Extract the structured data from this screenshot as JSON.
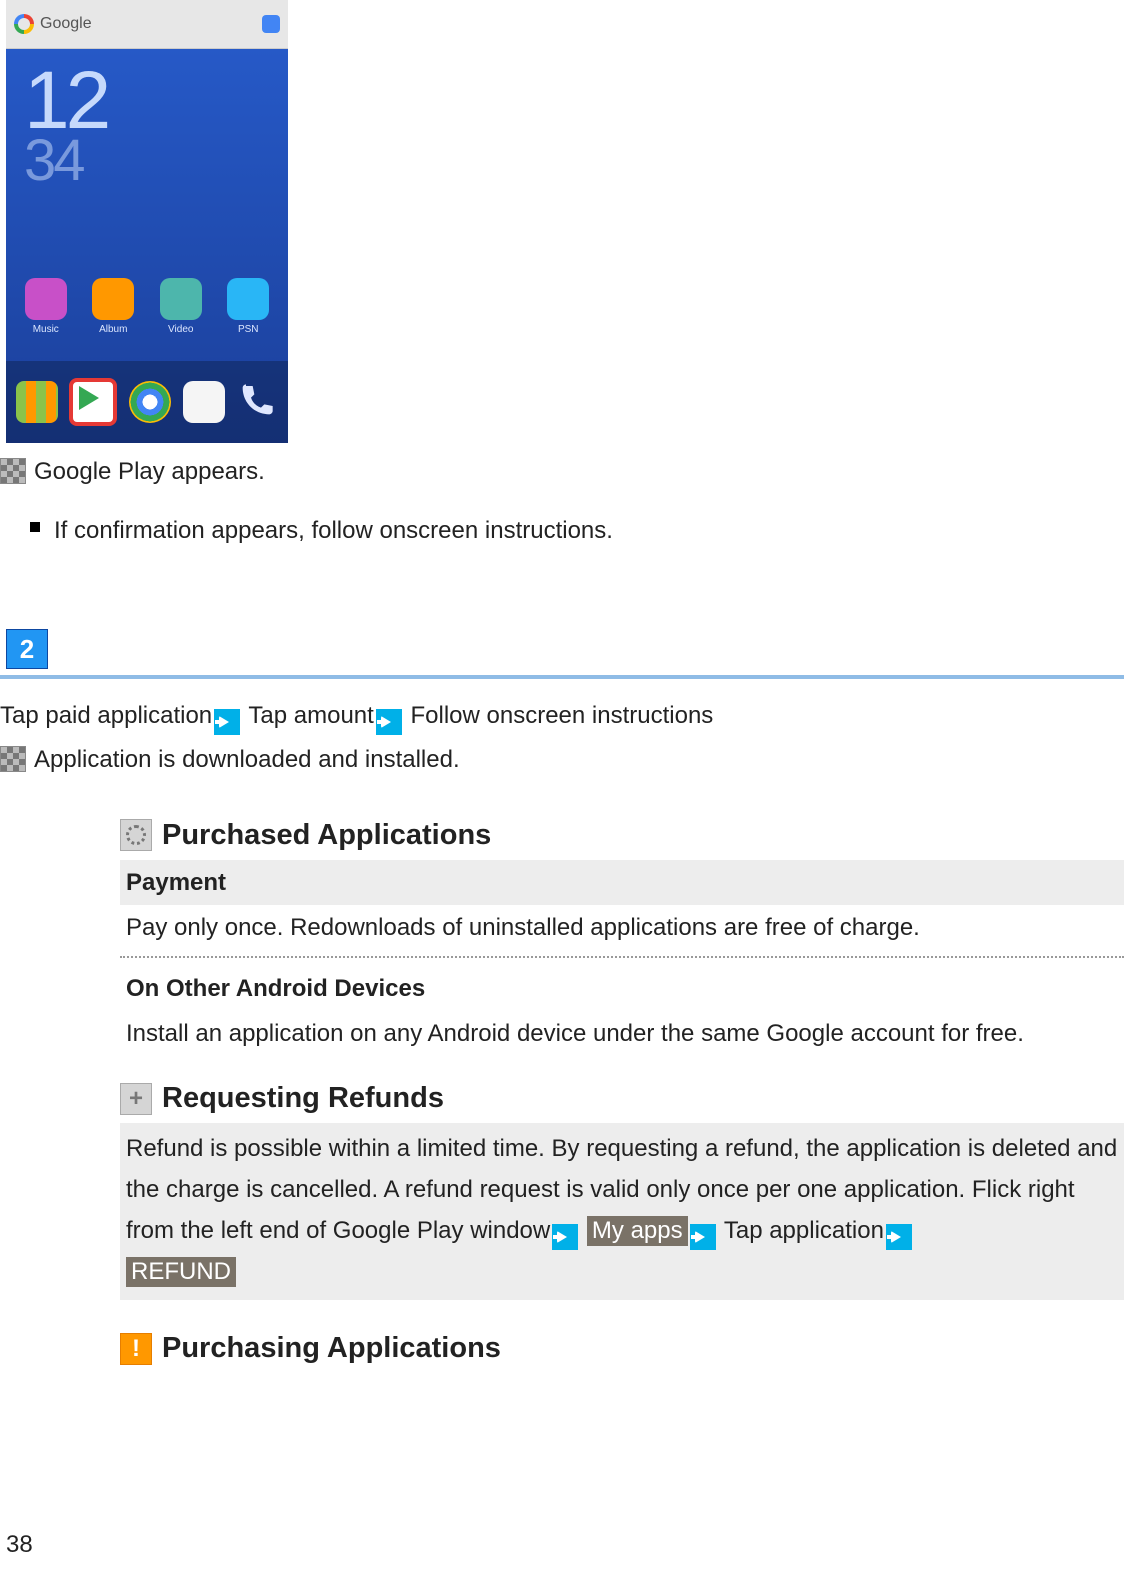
{
  "phone": {
    "status_text": "Google",
    "clock_big": "12",
    "clock_small": "34",
    "clock_date": "",
    "app_row": [
      {
        "label": "Music",
        "color": "#c850c8"
      },
      {
        "label": "Album",
        "color": "#ff9800"
      },
      {
        "label": "Video",
        "color": "#4db6ac"
      },
      {
        "label": "PSN",
        "color": "#29b6f6"
      }
    ]
  },
  "line_google_play": "Google Play appears.",
  "line_confirmation": "If confirmation appears, follow onscreen instructions.",
  "step_number": "2",
  "step2": {
    "part1": "Tap paid application",
    "part2": "Tap amount",
    "part3": "Follow onscreen instructions"
  },
  "line_downloaded": "Application is downloaded and installed.",
  "sec_purchased": {
    "title": "Purchased Applications",
    "payment_title": "Payment",
    "payment_body": "Pay only once. Redownloads of uninstalled applications are free of charge.",
    "other_title": "On Other Android Devices",
    "other_body": "Install an application on any Android device under the same Google account for free."
  },
  "sec_refunds": {
    "title": "Requesting Refunds",
    "body_before": "Refund is possible within a limited time. By requesting a refund, the application is deleted and the charge is cancelled. A refund request is valid only once per one application. Flick right from the left end of Google Play window",
    "label_myapps": "My apps",
    "body_middle": "Tap application",
    "label_refund": "REFUND"
  },
  "sec_purchasing": {
    "title": "Purchasing Applications"
  },
  "page_number": "38"
}
